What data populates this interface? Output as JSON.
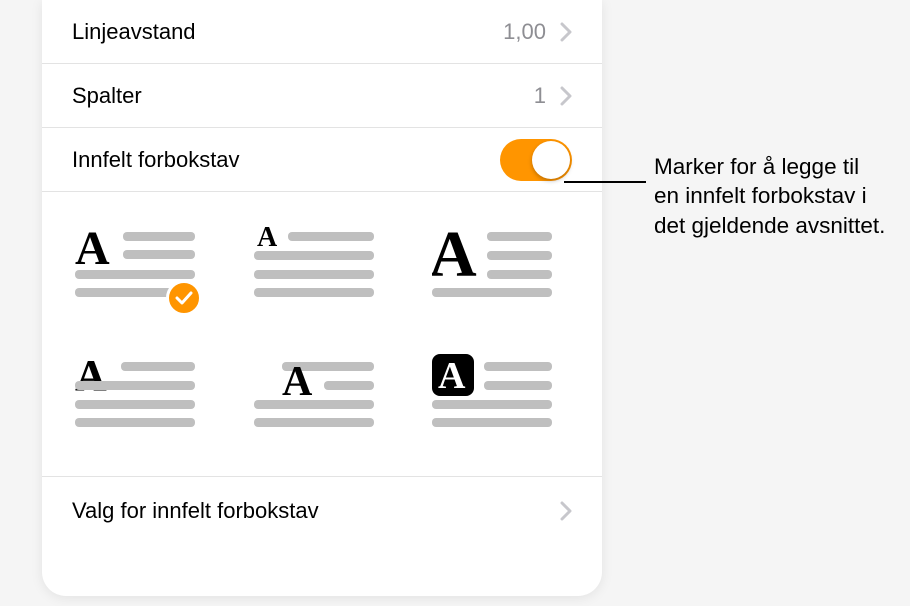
{
  "rows": {
    "lineSpacing": {
      "label": "Linjeavstand",
      "value": "1,00"
    },
    "columns": {
      "label": "Spalter",
      "value": "1"
    },
    "dropCap": {
      "label": "Innfelt forbokstav"
    },
    "options": {
      "label": "Valg for innfelt forbokstav"
    }
  },
  "callout": "Marker for å legge til en innfelt forbokstav i det gjeldende avsnittet."
}
